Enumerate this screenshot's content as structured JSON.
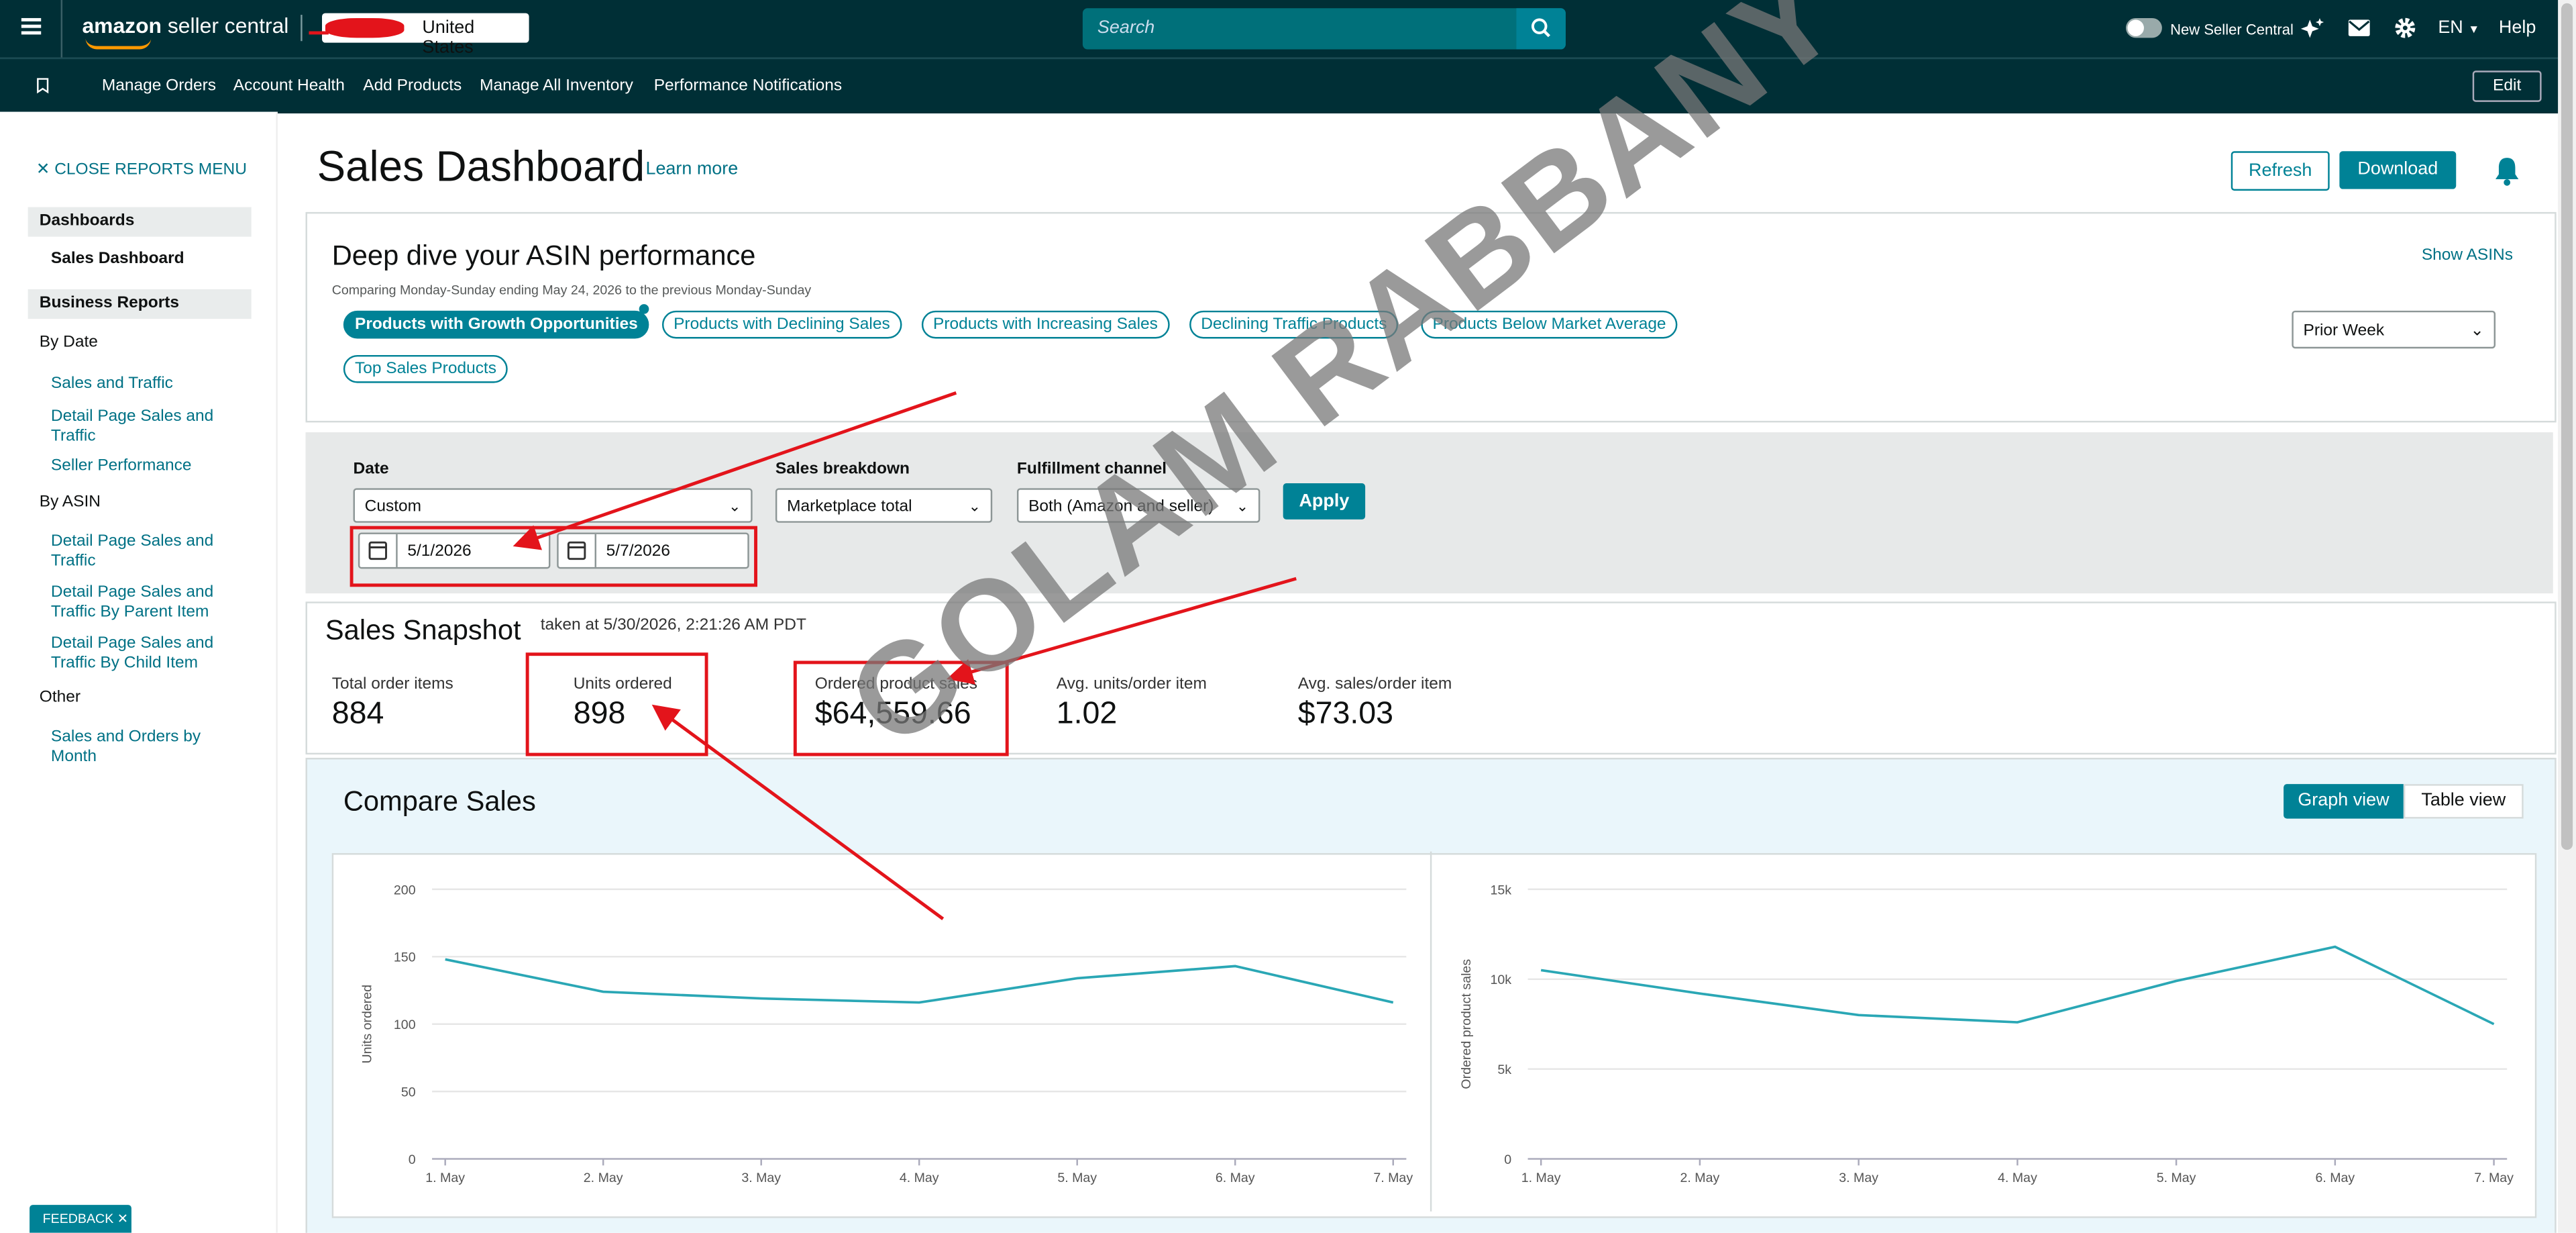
{
  "header": {
    "logo_main": "amazon",
    "logo_sub": "seller central",
    "marketplace": "United States",
    "search_placeholder": "Search",
    "new_seller_central": "New Seller Central",
    "language": "EN",
    "help": "Help"
  },
  "nav": {
    "items": [
      "Manage Orders",
      "Account Health",
      "Add Products",
      "Manage All Inventory",
      "Performance Notifications"
    ],
    "edit": "Edit"
  },
  "sidebar": {
    "close_menu": "CLOSE REPORTS MENU",
    "dashboards_head": "Dashboards",
    "sales_dashboard": "Sales Dashboard",
    "business_reports_head": "Business Reports",
    "by_date": "By Date",
    "sales_and_traffic": "Sales and Traffic",
    "detail_page_sales_traffic_1a": "Detail Page Sales and",
    "detail_page_sales_traffic_1b": "Traffic",
    "seller_performance": "Seller Performance",
    "by_asin": "By ASIN",
    "detail_page_sales_traffic_2a": "Detail Page Sales and",
    "detail_page_sales_traffic_2b": "Traffic",
    "parent_a": "Detail Page Sales and",
    "parent_b": "Traffic By Parent Item",
    "child_a": "Detail Page Sales and",
    "child_b": "Traffic By Child Item",
    "other": "Other",
    "sales_orders_month_a": "Sales and Orders by",
    "sales_orders_month_b": "Month"
  },
  "page": {
    "title": "Sales Dashboard",
    "learn_more": "Learn more",
    "refresh": "Refresh",
    "download": "Download"
  },
  "asin": {
    "title": "Deep dive your ASIN performance",
    "subtitle": "Comparing Monday-Sunday ending May 24, 2026 to the previous Monday-Sunday",
    "show_asins": "Show ASINs",
    "period": "Prior Week",
    "chips": [
      "Products with Growth Opportunities",
      "Products with Declining Sales",
      "Products with Increasing Sales",
      "Declining Traffic Products",
      "Products Below Market Average",
      "Top Sales Products"
    ]
  },
  "filters": {
    "date_label": "Date",
    "date_value": "Custom",
    "start_date": "5/1/2026",
    "end_date": "5/7/2026",
    "breakdown_label": "Sales breakdown",
    "breakdown_value": "Marketplace total",
    "channel_label": "Fulfillment channel",
    "channel_value": "Both (Amazon and seller)",
    "apply": "Apply"
  },
  "snapshot": {
    "title": "Sales Snapshot",
    "taken_at": "taken at 5/30/2026, 2:21:26 AM PDT",
    "metrics": [
      {
        "label": "Total order items",
        "value": "884"
      },
      {
        "label": "Units ordered",
        "value": "898"
      },
      {
        "label": "Ordered product sales",
        "value": "$64,559.66"
      },
      {
        "label": "Avg. units/order item",
        "value": "1.02"
      },
      {
        "label": "Avg. sales/order item",
        "value": "$73.03"
      }
    ]
  },
  "compare": {
    "title": "Compare Sales",
    "graph_view": "Graph view",
    "table_view": "Table view"
  },
  "chart_data": [
    {
      "type": "line",
      "x": [
        "1. May",
        "2. May",
        "3. May",
        "4. May",
        "5. May",
        "6. May",
        "7. May"
      ],
      "series": [
        {
          "values": [
            148,
            124,
            119,
            116,
            134,
            143,
            116
          ]
        }
      ],
      "ylabel": "Units ordered",
      "yticks": [
        "0",
        "50",
        "100",
        "150",
        "200"
      ],
      "ylim": [
        0,
        200
      ],
      "color": "#2aa7b5"
    },
    {
      "type": "line",
      "x": [
        "1. May",
        "2. May",
        "3. May",
        "4. May",
        "5. May",
        "6. May",
        "7. May"
      ],
      "series": [
        {
          "values": [
            10500,
            9200,
            8000,
            7600,
            9900,
            11800,
            7500
          ]
        }
      ],
      "ylabel": "Ordered product sales",
      "yticks": [
        "0",
        "5k",
        "10k",
        "15k"
      ],
      "ylim": [
        0,
        15000
      ],
      "color": "#2aa7b5"
    }
  ],
  "watermark": "GOLAM RABBANY",
  "feedback": "FEEDBACK"
}
